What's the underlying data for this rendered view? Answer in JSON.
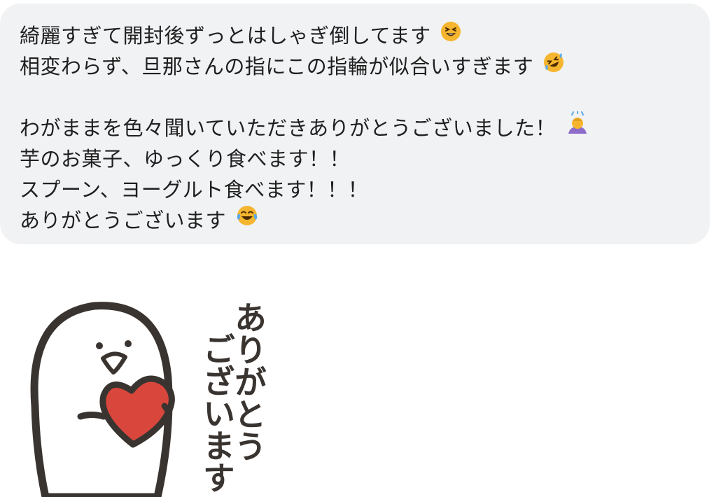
{
  "message": {
    "lines": [
      "綺麗すぎて開封後ずっとはしゃぎ倒してます",
      "相変わらず、旦那さんの指にこの指輪が似合いすぎます",
      "",
      "わがままを色々聞いていただきありがとうございました！",
      "芋のお菓子、ゆっくり食べます！！",
      "スプーン、ヨーグルト食べます！！！",
      "ありがとうございます"
    ],
    "emojis": [
      "grinning-squinting-face-emoji",
      "rolling-on-floor-laughing-emoji",
      "",
      "person-bowing-emoji",
      "",
      "",
      "face-with-tears-of-joy-emoji"
    ]
  },
  "sticker": {
    "text_col1": "ありがとう",
    "text_col2": "ございます",
    "colors": {
      "heart": "#d9473c",
      "outline": "#3a3431",
      "body": "#ffffff"
    }
  },
  "colors": {
    "bubble_bg": "#f1f2f4",
    "text": "#1f1f1f",
    "emoji_yellow": "#f5b52e"
  }
}
